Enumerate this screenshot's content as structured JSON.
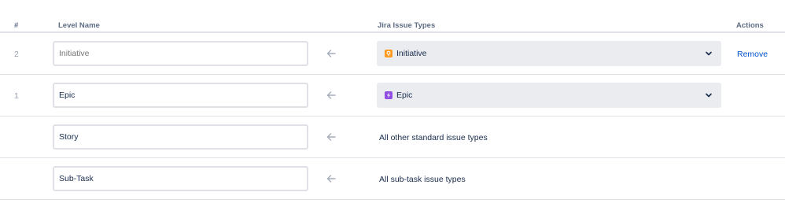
{
  "header": {
    "num": "#",
    "level_name": "Level Name",
    "jira_issue_types": "Jira Issue Types",
    "actions": "Actions"
  },
  "colors": {
    "initiative_icon": "#ff991f",
    "epic_icon": "#904ee2",
    "link": "#0052cc",
    "select_bg": "#ebecf0"
  },
  "rows": [
    {
      "num": "2",
      "level_name": "",
      "level_placeholder": "Initiative",
      "issue_type": {
        "icon": "initiative-icon",
        "label": "Initiative"
      },
      "action": "Remove"
    },
    {
      "num": "1",
      "level_name": "Epic",
      "issue_type": {
        "icon": "epic-icon",
        "label": "Epic"
      }
    },
    {
      "level_name": "Story",
      "issue_text": "All other standard issue types"
    },
    {
      "level_name": "Sub-Task",
      "issue_text": "All sub-task issue types"
    }
  ]
}
